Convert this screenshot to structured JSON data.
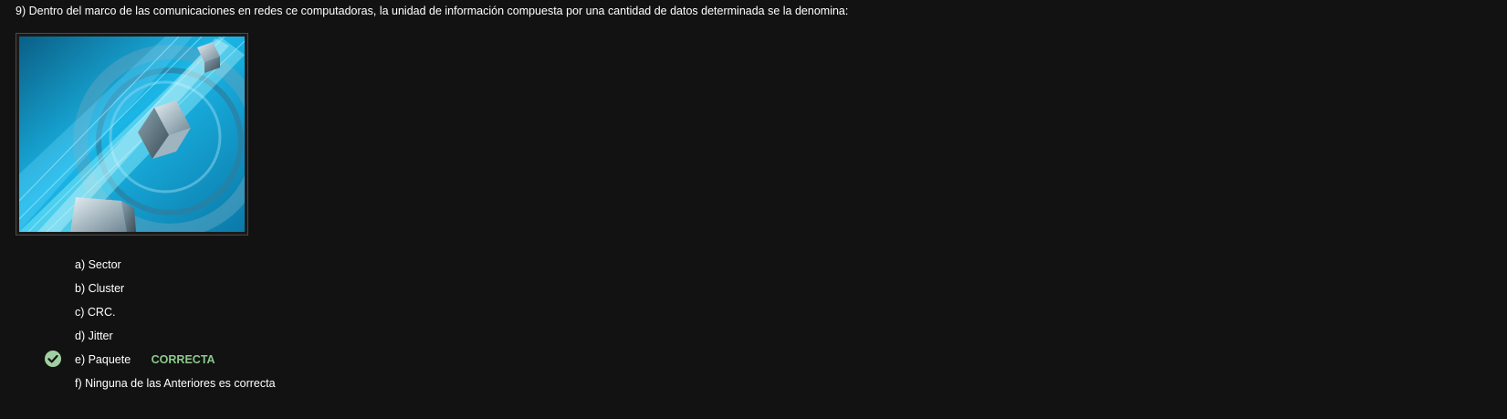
{
  "question": {
    "text": "9) Dentro del marco de las comunicaciones en redes ce computadoras, la unidad de información compuesta por una cantidad de datos determinada se la denomina:"
  },
  "options": [
    {
      "label": "a) Sector"
    },
    {
      "label": "b) Cluster"
    },
    {
      "label": "c) CRC."
    },
    {
      "label": "d) Jitter"
    },
    {
      "label": "e) Paquete",
      "tag": "CORRECTA"
    },
    {
      "label": "f) Ninguna de las Anteriores es correcta"
    }
  ],
  "icons": {
    "correct": "check-circle-icon"
  },
  "colors": {
    "background": "#121212",
    "correct": "#8cc88c"
  }
}
